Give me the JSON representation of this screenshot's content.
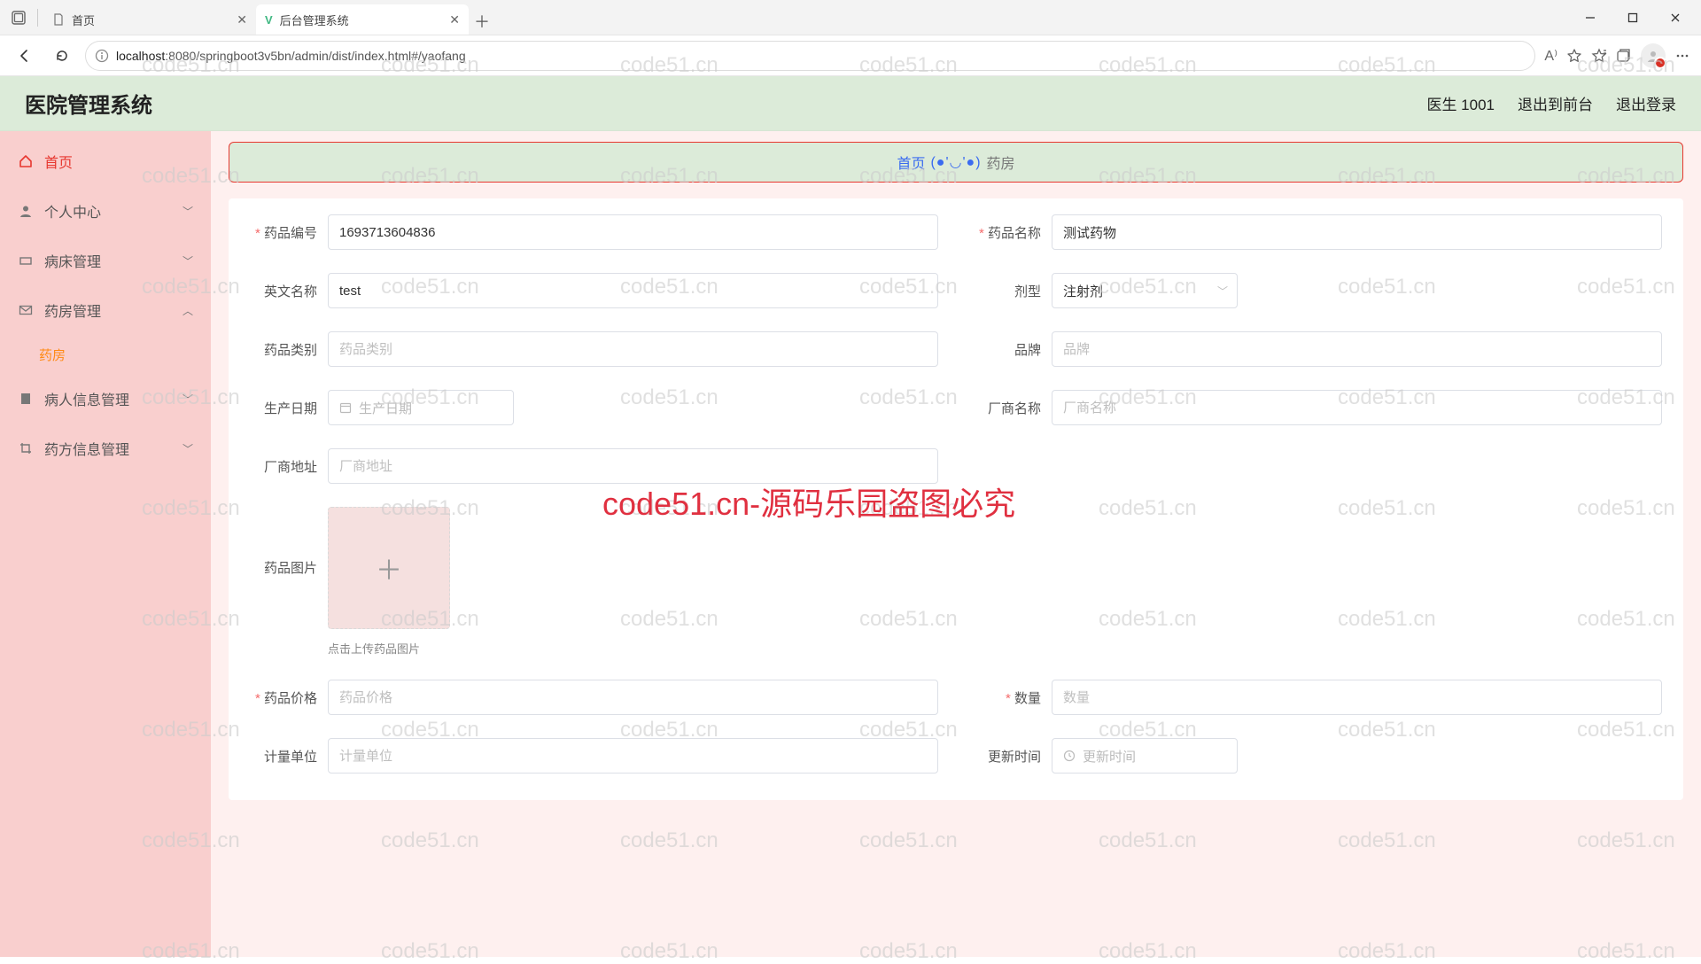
{
  "browser": {
    "tabs": [
      {
        "title": "首页",
        "active": false
      },
      {
        "title": "后台管理系统",
        "active": true
      }
    ],
    "url_host": "localhost",
    "url_port": ":8080",
    "url_path": "/springboot3v5bn/admin/dist/index.html#/yaofang"
  },
  "app": {
    "brand": "医院管理系统",
    "user": "医生 1001",
    "to_front": "退出到前台",
    "logout": "退出登录"
  },
  "sidebar": {
    "home": "首页",
    "items": [
      {
        "label": "个人中心",
        "icon": "user"
      },
      {
        "label": "病床管理",
        "icon": "bed"
      },
      {
        "label": "药房管理",
        "icon": "mail",
        "open": true,
        "children": [
          {
            "label": "药房",
            "active": true
          }
        ]
      },
      {
        "label": "病人信息管理",
        "icon": "doc"
      },
      {
        "label": "药方信息管理",
        "icon": "crop"
      }
    ]
  },
  "crumb": {
    "home": "首页",
    "face": "(●'◡'●)",
    "current": "药房"
  },
  "form": {
    "drug_no": {
      "label": "药品编号",
      "value": "1693713604836"
    },
    "drug_name": {
      "label": "药品名称",
      "value": "测试药物"
    },
    "en_name": {
      "label": "英文名称",
      "value": "test"
    },
    "dosage": {
      "label": "剂型",
      "value": "注射剂"
    },
    "category": {
      "label": "药品类别",
      "placeholder": "药品类别"
    },
    "brand": {
      "label": "品牌",
      "placeholder": "品牌"
    },
    "prod_date": {
      "label": "生产日期",
      "placeholder": "生产日期"
    },
    "maker_name": {
      "label": "厂商名称",
      "placeholder": "厂商名称"
    },
    "maker_addr": {
      "label": "厂商地址",
      "placeholder": "厂商地址"
    },
    "image": {
      "label": "药品图片",
      "hint": "点击上传药品图片"
    },
    "price": {
      "label": "药品价格",
      "placeholder": "药品价格"
    },
    "qty": {
      "label": "数量",
      "placeholder": "数量"
    },
    "unit": {
      "label": "计量单位",
      "placeholder": "计量单位"
    },
    "update_time": {
      "label": "更新时间",
      "placeholder": "更新时间"
    }
  },
  "watermark": {
    "text": "code51.cn",
    "big": "code51.cn-源码乐园盗图必究"
  }
}
